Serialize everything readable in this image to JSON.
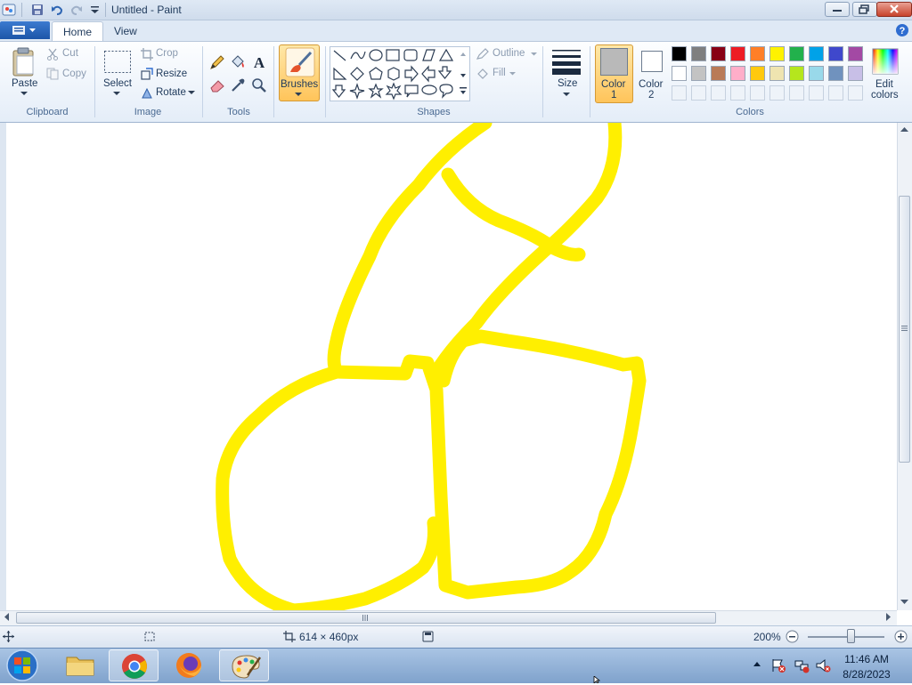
{
  "window": {
    "title": "Untitled - Paint"
  },
  "tabs": [
    {
      "label": "Home"
    },
    {
      "label": "View"
    }
  ],
  "clipboard": {
    "paste": "Paste",
    "cut": "Cut",
    "copy": "Copy",
    "group": "Clipboard"
  },
  "image": {
    "select": "Select",
    "crop": "Crop",
    "resize": "Resize",
    "rotate": "Rotate",
    "group": "Image"
  },
  "tools": {
    "group": "Tools"
  },
  "brushes": {
    "label": "Brushes"
  },
  "shapes": {
    "outline": "Outline",
    "fill": "Fill",
    "group": "Shapes"
  },
  "size": {
    "label": "Size"
  },
  "colors": {
    "color1_label": "Color",
    "color1_num": "1",
    "color2_label": "Color",
    "color2_num": "2",
    "color1_value": "#b9b9b9",
    "color2_value": "#ffffff",
    "edit_line1": "Edit",
    "edit_line2": "colors",
    "group": "Colors",
    "palette_row1": [
      "#000000",
      "#7f7f7f",
      "#880015",
      "#ed1c24",
      "#ff7f27",
      "#fff200",
      "#22b14c",
      "#00a2e8",
      "#3f48cc",
      "#a349a4"
    ],
    "palette_row2": [
      "#ffffff",
      "#c3c3c3",
      "#b97a57",
      "#ffaec9",
      "#ffc90e",
      "#efe4b0",
      "#b5e61d",
      "#99d9ea",
      "#7092be",
      "#c8bfe7"
    ]
  },
  "canvas": {
    "stroke_color": "#ffef00"
  },
  "status": {
    "dimensions": "614 × 460px",
    "zoom": "200%"
  },
  "clock": {
    "time": "11:46 AM",
    "date": "8/28/2023"
  }
}
